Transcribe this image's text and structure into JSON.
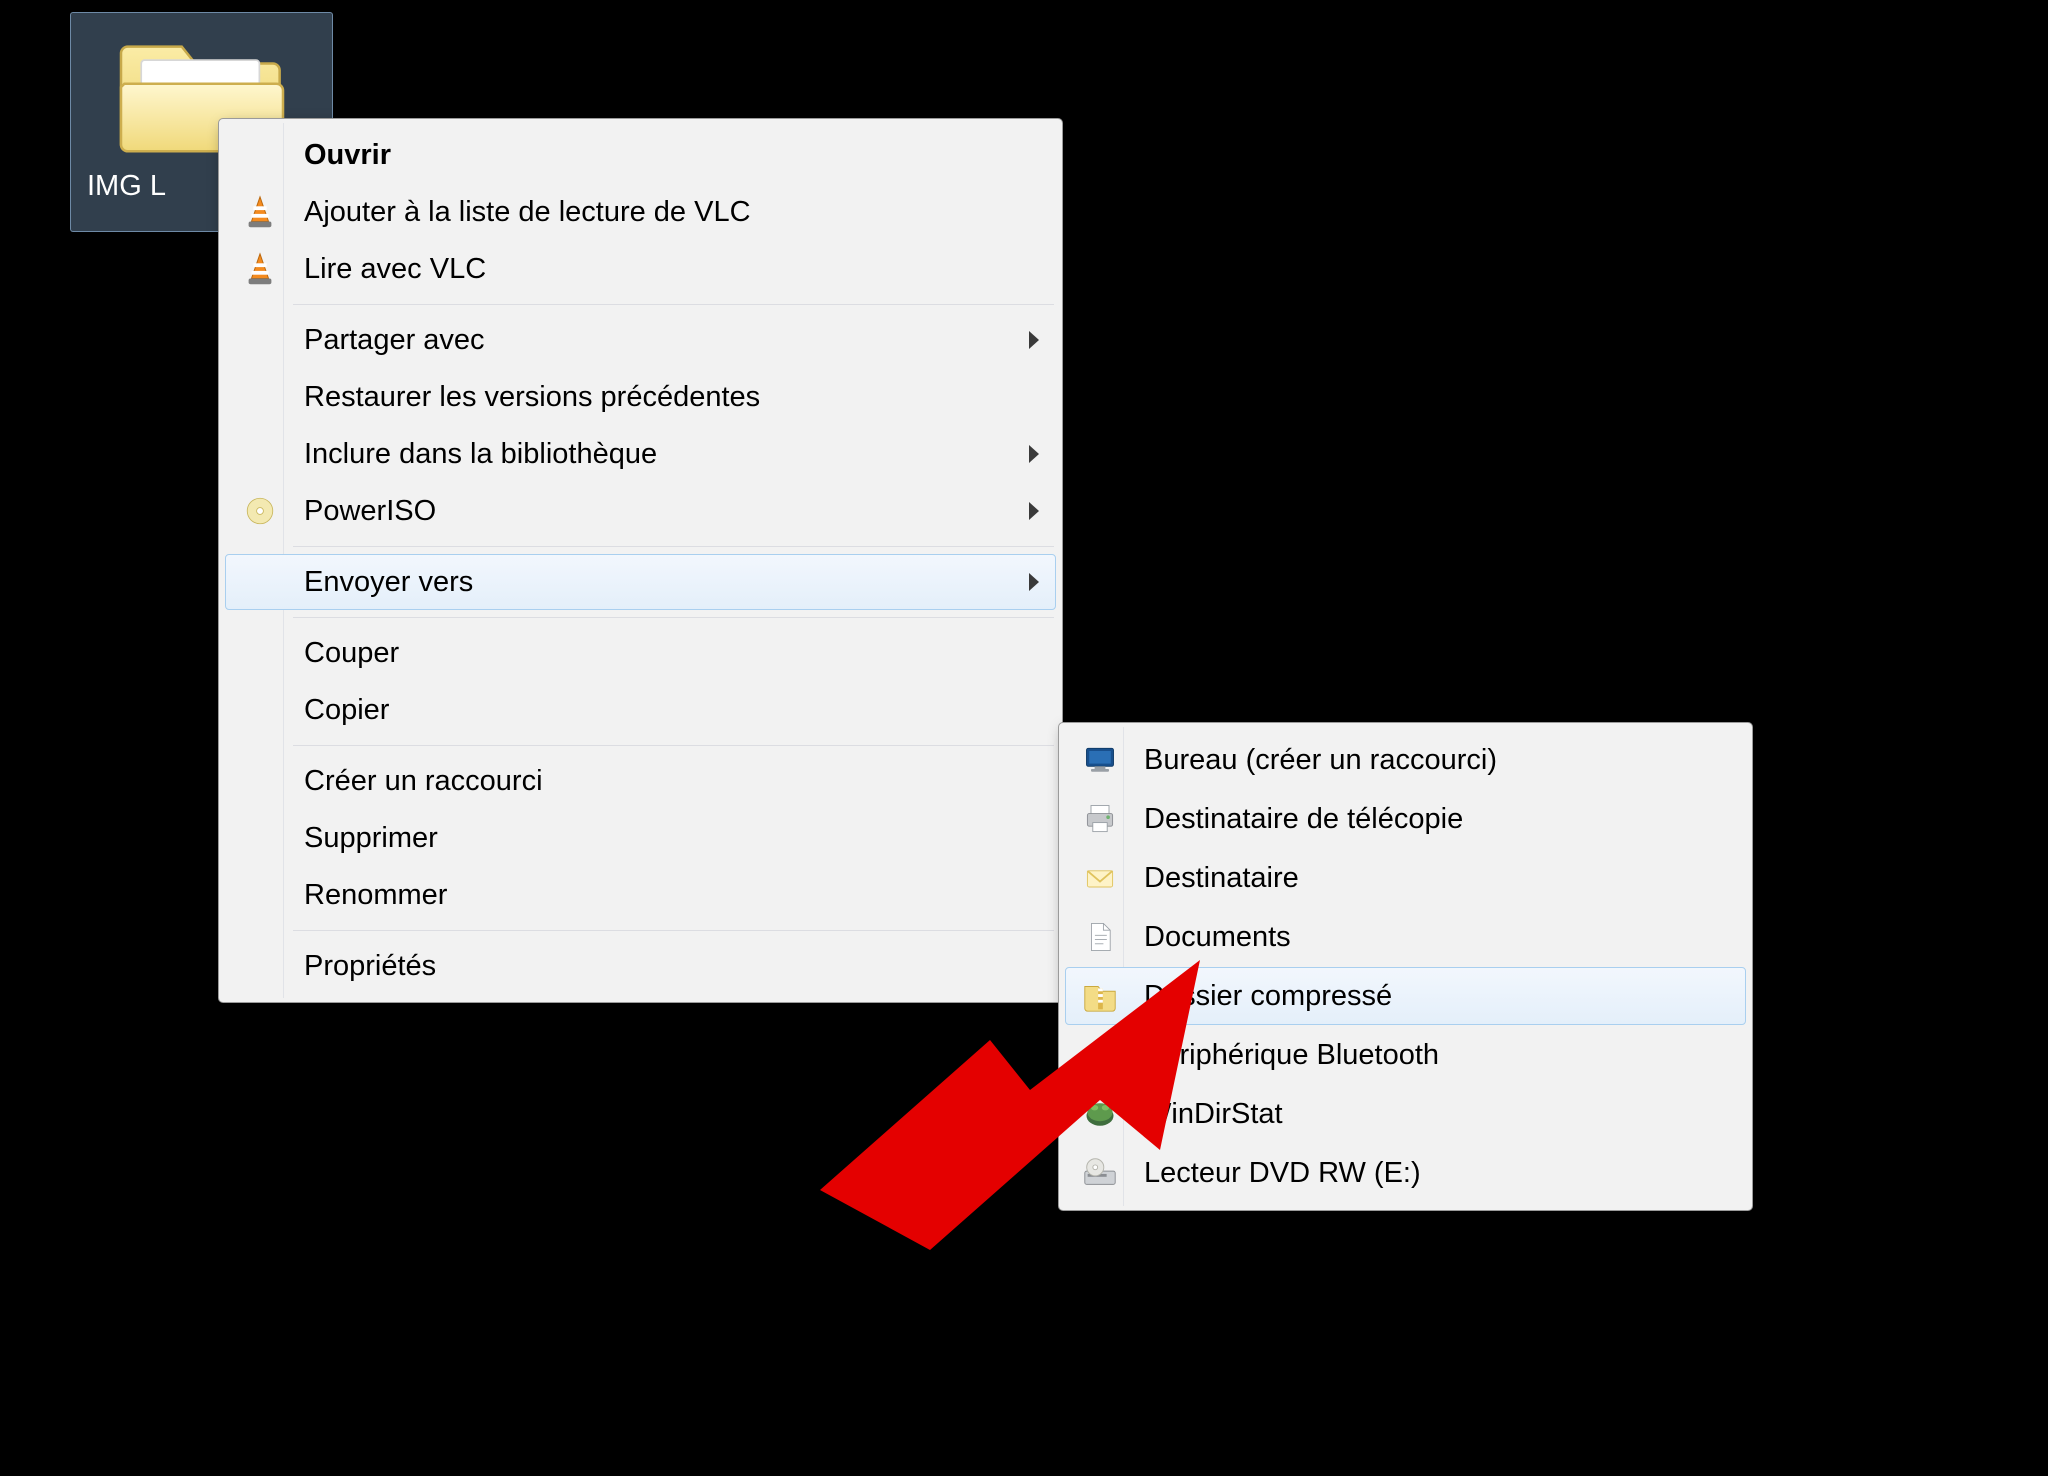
{
  "desktop": {
    "folder_label": "IMG L"
  },
  "main_menu": {
    "items": {
      "open": "Ouvrir",
      "vlc_add": "Ajouter à la liste de lecture de VLC",
      "vlc_play": "Lire avec VLC",
      "share": "Partager avec",
      "restore": "Restaurer les versions précédentes",
      "library": "Inclure dans la bibliothèque",
      "poweriso": "PowerISO",
      "sendto": "Envoyer vers",
      "cut": "Couper",
      "copy": "Copier",
      "shortcut": "Créer un raccourci",
      "delete": "Supprimer",
      "rename": "Renommer",
      "properties": "Propriétés"
    }
  },
  "sub_menu": {
    "items": {
      "desktop": "Bureau (créer un raccourci)",
      "fax": "Destinataire de télécopie",
      "mail": "Destinataire",
      "documents": "Documents",
      "zip": "Dossier compressé",
      "bluetooth": "Périphérique Bluetooth",
      "windirstat": "WinDirStat",
      "dvd": "Lecteur DVD RW (E:)"
    }
  }
}
